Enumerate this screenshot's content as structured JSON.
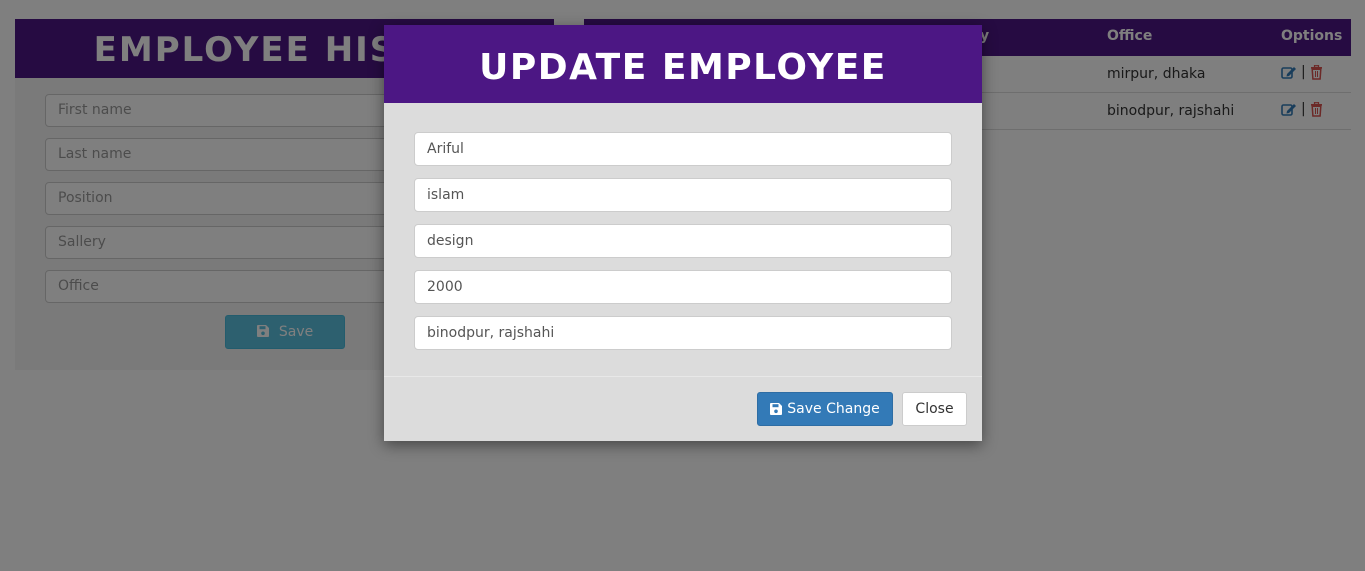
{
  "background": {
    "left_panel": {
      "title": "EMPLOYEE HISTORY",
      "placeholders": [
        "First name",
        "Last name",
        "Position",
        "Sallery",
        "Office"
      ],
      "save_label": "Save"
    },
    "table": {
      "headers": {
        "sallery_tail": "y",
        "office": "Office",
        "options": "Options"
      },
      "rows": [
        {
          "office": "mirpur, dhaka"
        },
        {
          "office": "binodpur, rajshahi"
        }
      ],
      "separator": "|"
    }
  },
  "modal": {
    "title": "UPDATE EMPLOYEE",
    "fields": {
      "first_name": "Ariful",
      "last_name": "islam",
      "position": "design",
      "sallery": "2000",
      "office": "binodpur, rajshahi"
    },
    "save_change_label": "Save Change",
    "close_label": "Close"
  },
  "colors": {
    "header_purple": "#4c1784",
    "primary_blue": "#337ab7",
    "info_cyan": "#5bc0de",
    "delete_red": "#d9534f"
  },
  "icons": [
    "floppy-disk-icon",
    "edit-icon",
    "trash-icon"
  ]
}
